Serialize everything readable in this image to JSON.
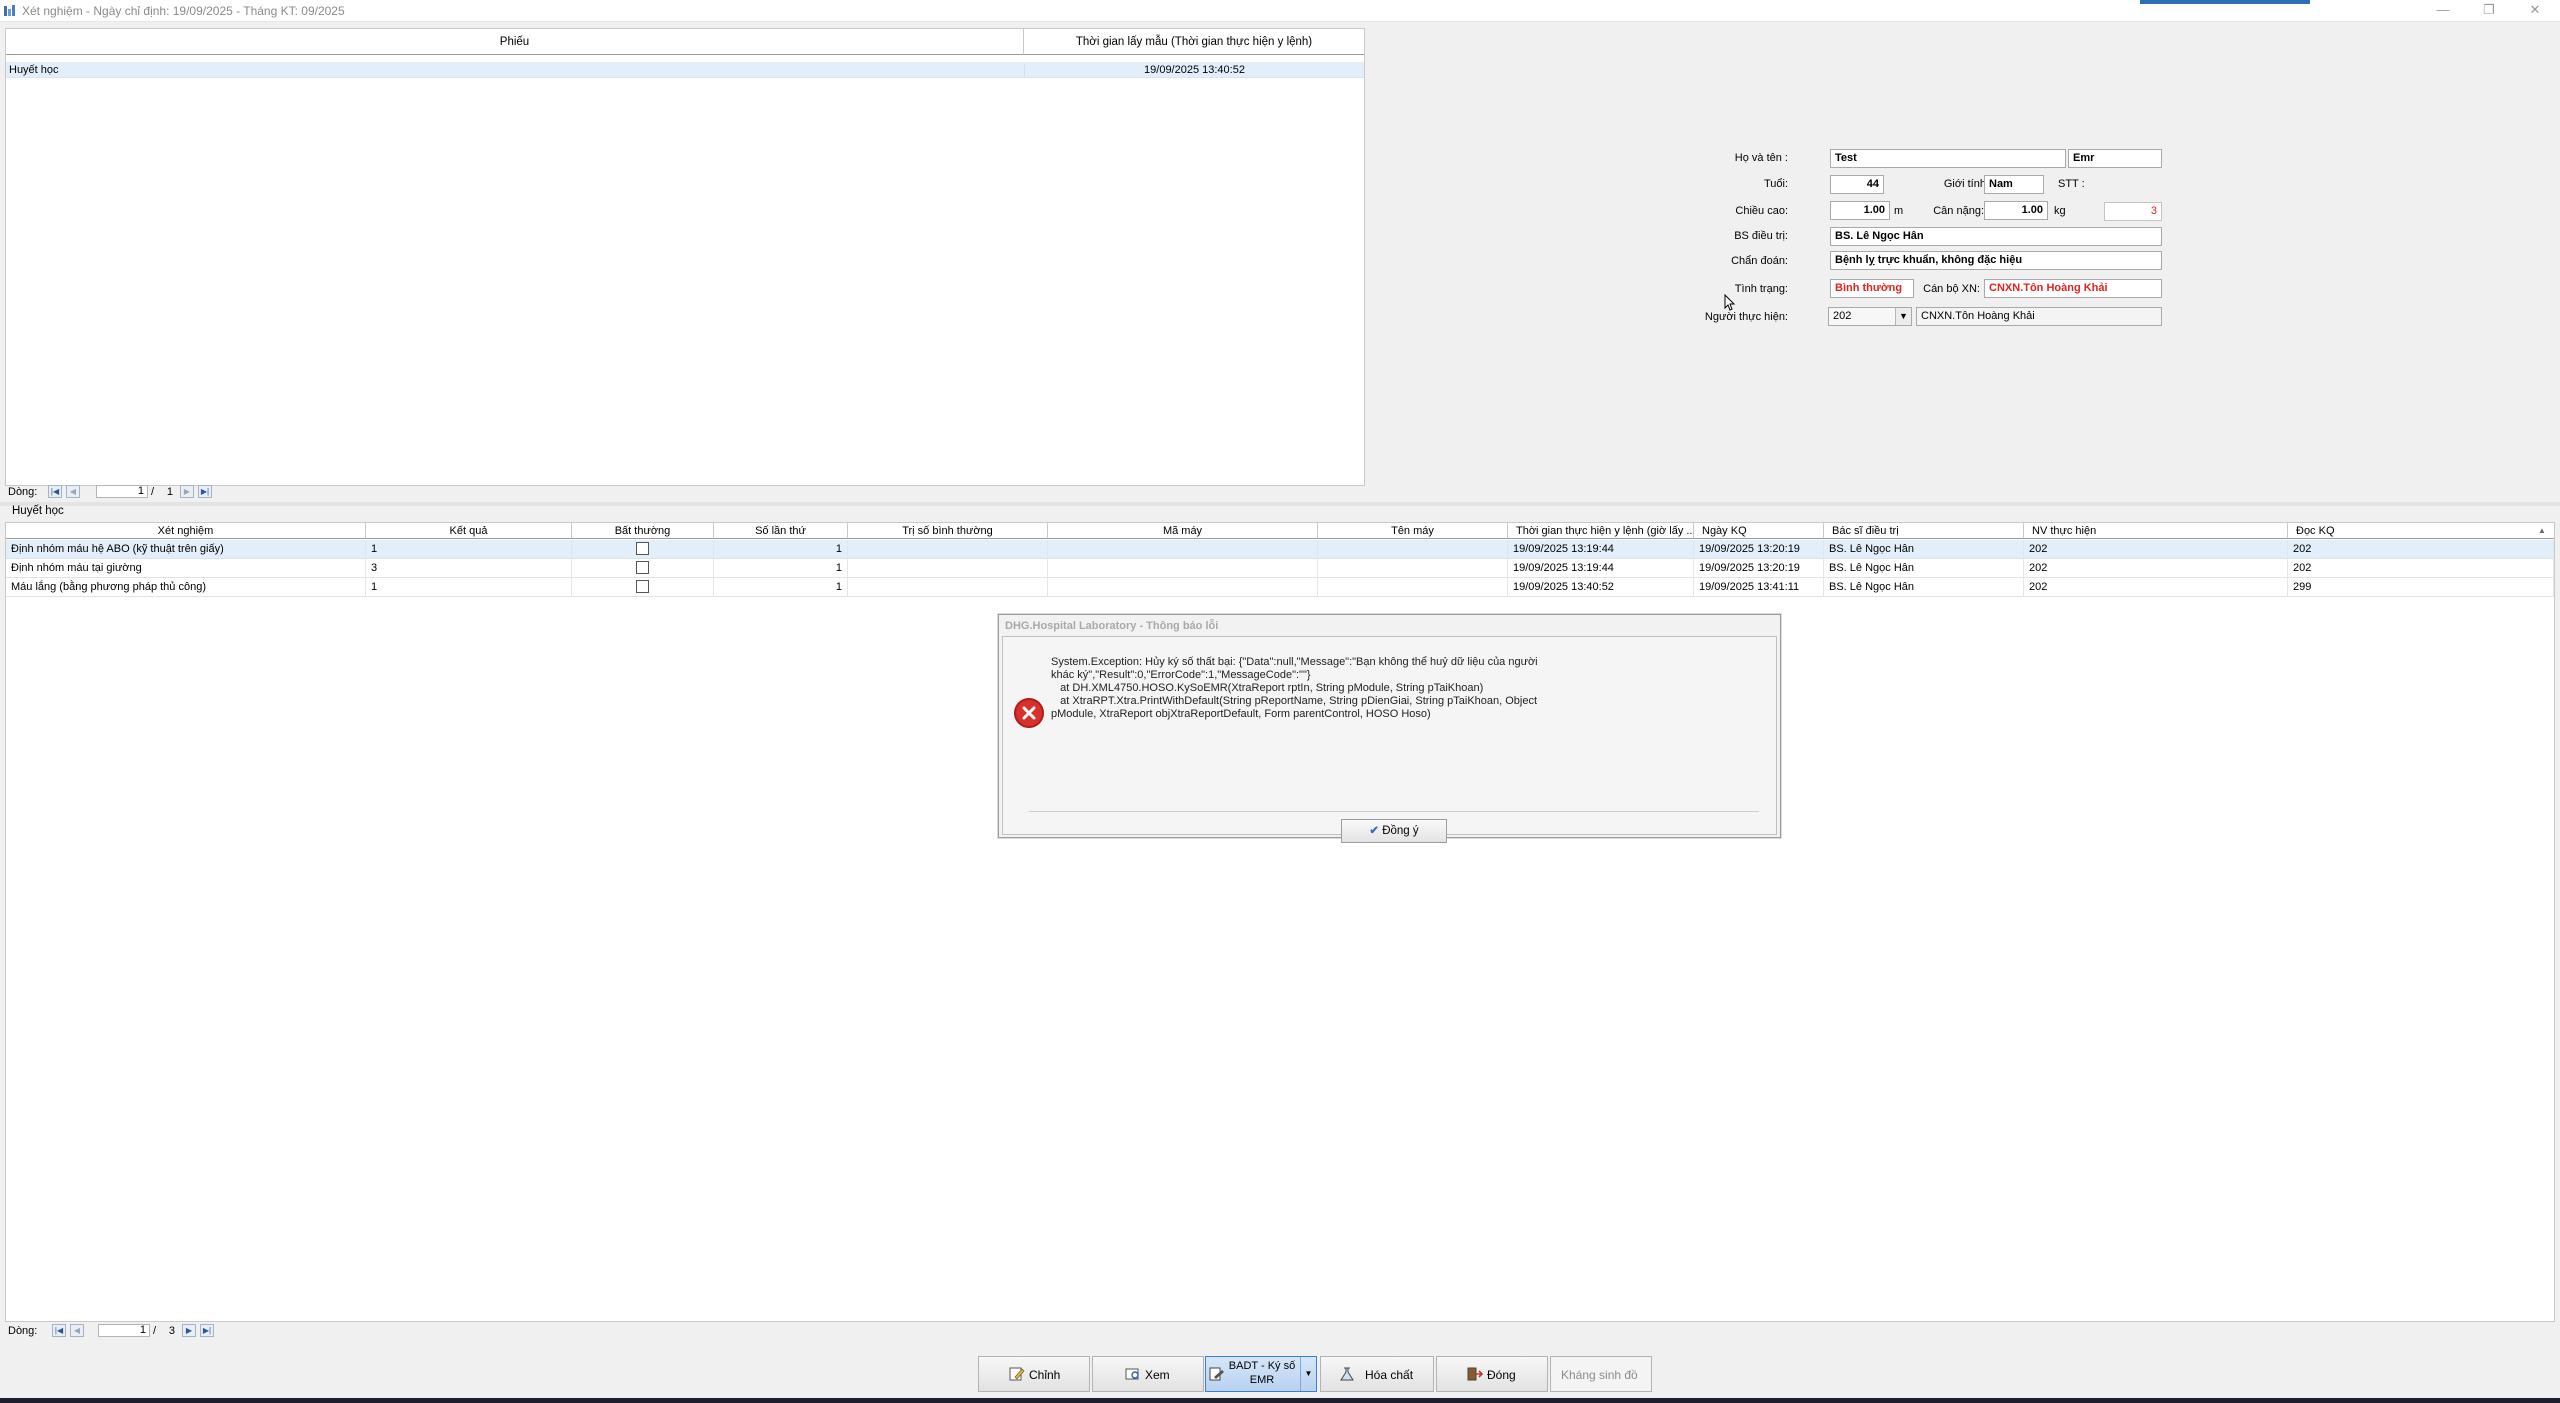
{
  "window": {
    "title": "Xét nghiệm - Ngày chỉ định: 19/09/2025 - Tháng KT: 09/2025",
    "min_glyph": "—",
    "max_glyph": "❐",
    "close_glyph": "✕"
  },
  "top_grid": {
    "headers": [
      "Phiếu",
      "Thời gian lấy mẫu (Thời gian thực hiện y lệnh)"
    ],
    "rows": [
      {
        "phieu": "Huyết học",
        "thoi_gian": "19/09/2025 13:40:52"
      }
    ],
    "pager": {
      "label": "Dòng:",
      "current": "1",
      "slash": "/",
      "total": "1"
    }
  },
  "patient_form": {
    "ho_va_ten_label": "Họ và tên :",
    "ho_va_ten": "Test",
    "ten_phu": "Emr",
    "tuoi_label": "Tuổi:",
    "tuoi": "44",
    "gioi_tinh_label": "Giới tính:",
    "gioi_tinh": "Nam",
    "stt_label": "STT :",
    "chieu_cao_label": "Chiều cao:",
    "chieu_cao": "1.00",
    "chieu_cao_unit": "m",
    "can_nang_label": "Cân nặng:",
    "can_nang": "1.00",
    "can_nang_unit": "kg",
    "stt_value": "3",
    "bs_dieu_tri_label": "BS điều trị:",
    "bs_dieu_tri": "BS. Lê Ngọc Hân",
    "chan_doan_label": "Chẩn đoán:",
    "chan_doan": "Bệnh lỵ trực khuẩn, không đặc hiệu",
    "tinh_trang_label": "Tình trạng:",
    "tinh_trang": "Bình thường",
    "can_bo_xn_label": "Cán bộ XN:",
    "can_bo_xn": "CNXN.Tôn Hoàng Khải",
    "nguoi_thuc_hien_label": "Người thực hiện:",
    "nguoi_thuc_hien_code": "202",
    "nguoi_thuc_hien_name": "CNXN.Tôn Hoàng Khải"
  },
  "group": {
    "title": "Huyết học"
  },
  "result_grid": {
    "headers": [
      "Xét nghiệm",
      "Kết quả",
      "Bất thường",
      "Số lần thứ",
      "Trị số bình thường",
      "Mã máy",
      "Tên máy",
      "Thời gian thực hiện y lệnh (giờ lấy ...",
      "Ngày KQ",
      "Bác sĩ điều trị",
      "NV thực hiện",
      "Đọc KQ"
    ],
    "sort_glyph": "▲",
    "rows": [
      {
        "xet_nghiem": "Định nhóm máu hệ ABO (kỹ thuật trên giấy)",
        "ket_qua": "1",
        "so_lan": "1",
        "tri_so": "",
        "ma_may": "",
        "ten_may": "",
        "thoi_gian": "19/09/2025 13:19:44",
        "ngay_kq": "19/09/2025 13:20:19",
        "bac_si": "BS. Lê Ngọc Hân",
        "nv": "202",
        "doc_kq": "202"
      },
      {
        "xet_nghiem": "Định nhóm máu tại giường",
        "ket_qua": "3",
        "so_lan": "1",
        "tri_so": "",
        "ma_may": "",
        "ten_may": "",
        "thoi_gian": "19/09/2025 13:19:44",
        "ngay_kq": "19/09/2025 13:20:19",
        "bac_si": "BS. Lê Ngọc Hân",
        "nv": "202",
        "doc_kq": "202"
      },
      {
        "xet_nghiem": "Máu lắng (bằng phương pháp thủ công)",
        "ket_qua": "1",
        "so_lan": "1",
        "tri_so": "",
        "ma_may": "",
        "ten_may": "",
        "thoi_gian": "19/09/2025 13:40:52",
        "ngay_kq": "19/09/2025 13:41:11",
        "bac_si": "BS. Lê Ngọc Hân",
        "nv": "202",
        "doc_kq": "299"
      }
    ],
    "pager": {
      "label": "Dòng:",
      "current": "1",
      "slash": "/",
      "total": "3"
    }
  },
  "dialog": {
    "title": "DHG.Hospital Laboratory - Thông báo lỗi",
    "message": "System.Exception: Hủy ký số thất bại: {\"Data\":null,\"Message\":\"Bạn không thể huỷ dữ liệu của người khác ký\",\"Result\":0,\"ErrorCode\":1,\"MessageCode\":\"\"}\n   at DH.XML4750.HOSO.KySoEMR(XtraReport rptIn, String pModule, String pTaiKhoan)\n   at XtraRPT.Xtra.PrintWithDefault(String pReportName, String pDienGiai, String pTaiKhoan, Object pModule, XtraReport objXtraReportDefault, Form parentControl, HOSO Hoso)",
    "ok_label": "Đồng ý"
  },
  "toolbar": {
    "chinh": "Chỉnh",
    "xem": "Xem",
    "badt_line1": "BADT - Ký số",
    "badt_line2": "EMR",
    "hoa_chat": "Hóa chất",
    "dong": "Đóng",
    "khang_sinh_do": "Kháng sinh đồ"
  },
  "colors": {
    "accent_blue": "#2b6fb6",
    "selection": "#e2eef9",
    "error_red": "#d8302a",
    "alert_text": "#e0231f"
  }
}
